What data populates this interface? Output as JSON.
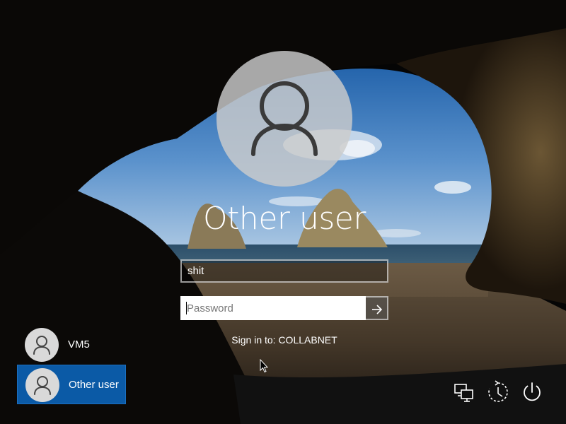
{
  "login": {
    "title": "Other user",
    "username_value": "shit",
    "password_placeholder": "Password",
    "domain_text": "Sign in to: COLLABNET"
  },
  "user_list": [
    {
      "name": "VM5",
      "selected": false
    },
    {
      "name": "Other user",
      "selected": true
    }
  ],
  "tray_icons": [
    "network-icon",
    "ease-of-access-icon",
    "power-icon"
  ],
  "colors": {
    "selected_tile": "#0b5aa6",
    "avatar_bg": "#cccccc",
    "text": "#ffffff"
  }
}
